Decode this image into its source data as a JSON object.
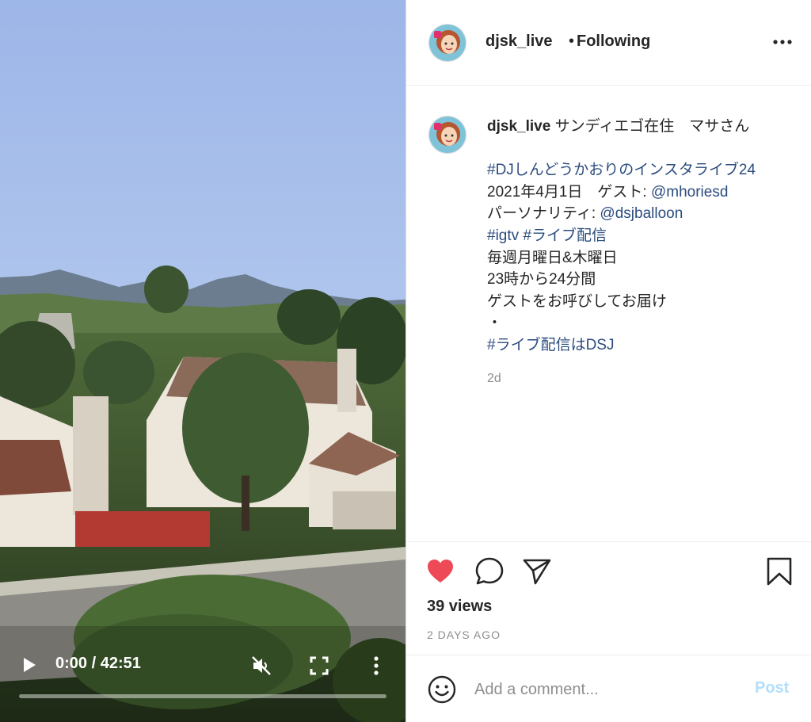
{
  "video": {
    "time_display": "0:00 / 42:51",
    "progress": 0,
    "muted": true
  },
  "header": {
    "username": "djsk_live",
    "separator": "•",
    "follow_status": "Following"
  },
  "caption": {
    "username": "djsk_live",
    "first_line_text": "サンディエゴ在住　マサさん",
    "lines": [
      [
        {
          "text": "#DJしんどうかおりのインスタライブ24",
          "link": true
        }
      ],
      [
        {
          "text": "2021年4月1日　ゲスト: ",
          "link": false
        },
        {
          "text": "@mhoriesd",
          "link": true
        }
      ],
      [
        {
          "text": "パーソナリティ: ",
          "link": false
        },
        {
          "text": "@dsjballoon",
          "link": true
        }
      ],
      [
        {
          "text": "#igtv",
          "link": true
        },
        {
          "text": " ",
          "link": false
        },
        {
          "text": "#ライブ配信",
          "link": true
        }
      ],
      [
        {
          "text": "毎週月曜日&木曜日",
          "link": false
        }
      ],
      [
        {
          "text": "23時から24分間",
          "link": false
        }
      ],
      [
        {
          "text": "ゲストをお呼びしてお届け",
          "link": false
        }
      ],
      [
        {
          "text": "・",
          "link": false
        }
      ],
      [
        {
          "text": "#ライブ配信はDSJ",
          "link": true
        }
      ]
    ],
    "posted_ago": "2d"
  },
  "actions": {
    "liked": true,
    "icons": [
      "heart-icon",
      "comment-icon",
      "share-icon",
      "bookmark-icon"
    ],
    "views": "39 views",
    "date": "2 DAYS AGO"
  },
  "comment_box": {
    "placeholder": "Add a comment...",
    "post_label": "Post"
  },
  "colors": {
    "link": "#2b4c7e",
    "like": "#ed4956",
    "muted_text": "#8e8e8e",
    "post_disabled": "#b2dffc"
  }
}
